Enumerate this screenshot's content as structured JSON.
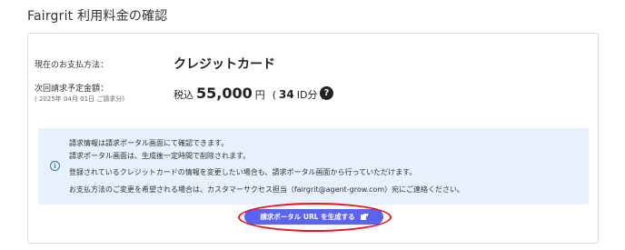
{
  "page": {
    "title": "Fairgrit 利用料金の確認"
  },
  "billing": {
    "payment_method_label": "現在のお支払方法：",
    "payment_method_value": "クレジットカード",
    "next_billing_label": "次回請求予定金額：",
    "next_billing_sub": "( 2025年 04月 01日 ご請求分)",
    "amount_prefix": "税込",
    "amount_value": "55,000",
    "amount_unit": "円",
    "paren_open": "(",
    "id_count": "34",
    "id_suffix": "ID分 )",
    "help_icon": "question-circle-icon"
  },
  "info": {
    "icon": "info-circle-icon",
    "lines": [
      "請求情報は請求ポータル画面にて確認できます。",
      "請求ポータル画面は、生成後一定時間で削除されます。",
      "登録されているクレジットカードの情報を変更したい場合も、請求ポータル画面から行っていただけます。",
      "お支払方法のご変更を希望される場合は、カスタマーサクセス担当（fairgrit@agent-grow.com）宛にご連絡ください。"
    ]
  },
  "actions": {
    "generate_label": "請求ポータル URL を生成する",
    "generate_icon": "external-link-icon",
    "button_color": "#5b63f0",
    "highlight_color": "#e8141e"
  }
}
